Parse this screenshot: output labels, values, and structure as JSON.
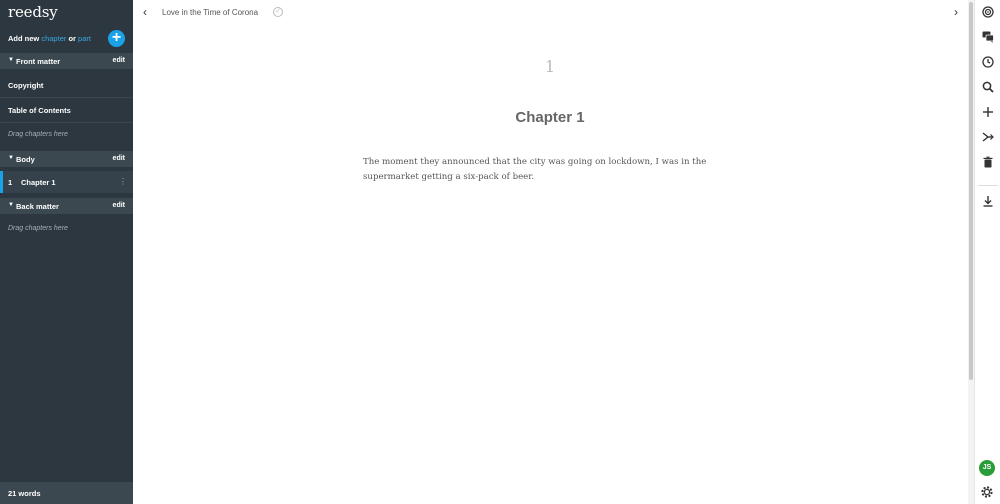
{
  "sidebar": {
    "logo": "reedsy",
    "add": {
      "prefix": "Add new ",
      "chapter": "chapter",
      "or": " or ",
      "part": "part",
      "button": "+"
    },
    "front_matter": {
      "title": "Front matter",
      "edit": "edit",
      "items": [
        "Copyright",
        "Table of Contents"
      ],
      "drag_hint": "Drag chapters here"
    },
    "body": {
      "title": "Body",
      "edit": "edit",
      "chapters": [
        {
          "number": "1",
          "title": "Chapter 1"
        }
      ]
    },
    "back_matter": {
      "title": "Back matter",
      "edit": "edit",
      "drag_hint": "Drag chapters here"
    },
    "word_count": "21 words"
  },
  "header": {
    "book_title": "Love in the Time of Corona"
  },
  "editor": {
    "chapter_number": "1",
    "chapter_title": "Chapter 1",
    "text": "The moment they announced that the city was going on lockdown, I was in the supermarket getting a six-pack of beer."
  },
  "toolbar": {
    "icons": [
      "goal-icon",
      "comments-icon",
      "history-icon",
      "search-icon",
      "plus-icon",
      "split-icon",
      "trash-icon",
      "download-icon"
    ],
    "avatar": "JS"
  },
  "colors": {
    "sidebar_bg": "#2c373f",
    "accent": "#1aa1e8",
    "avatar": "#2a9d3a"
  }
}
